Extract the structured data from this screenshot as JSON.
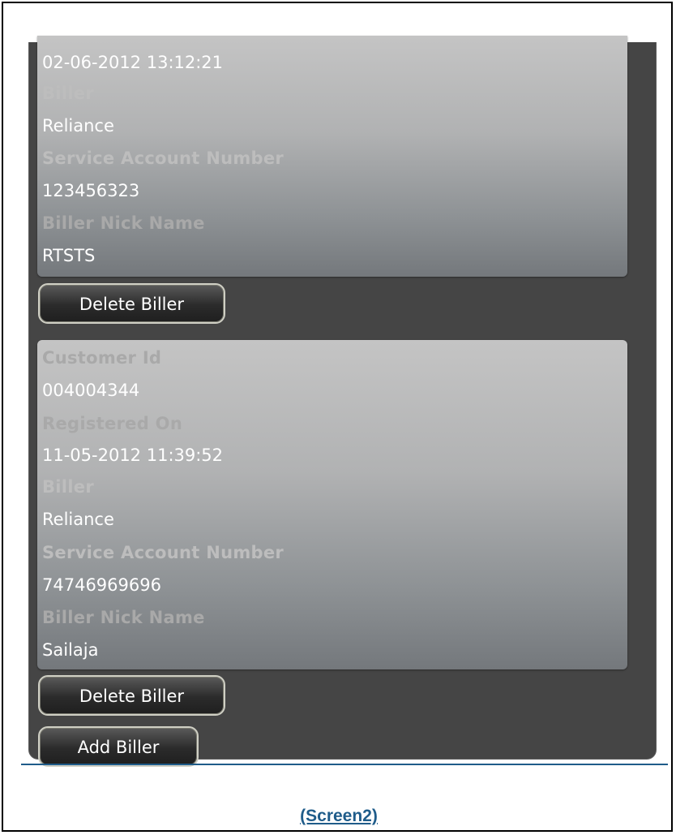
{
  "biller_1": {
    "registered_on_value": "02-06-2012 13:12:21",
    "biller_label": "Biller",
    "biller_value": "Reliance",
    "service_account_label": "Service Account Number",
    "service_account_value": "123456323",
    "nick_name_label": "Biller Nick Name",
    "nick_name_value": "RTSTS",
    "delete_label": "Delete Biller"
  },
  "biller_2": {
    "customer_id_label": "Customer Id",
    "customer_id_value": "004004344",
    "registered_on_label": "Registered On",
    "registered_on_value": "11-05-2012 11:39:52",
    "biller_label": "Biller",
    "biller_value": "Reliance",
    "service_account_label": "Service Account Number",
    "service_account_value": "74746969696",
    "nick_name_label": "Biller Nick Name",
    "nick_name_value": "Sailaja",
    "delete_label": "Delete Biller"
  },
  "add_biller_label": "Add Biller",
  "caption": "(Screen2)",
  "colors": {
    "panel_background": "#454545",
    "label_text": "#a9a9a9",
    "value_text": "#ffffff",
    "caption_link": "#1f5c8a"
  }
}
